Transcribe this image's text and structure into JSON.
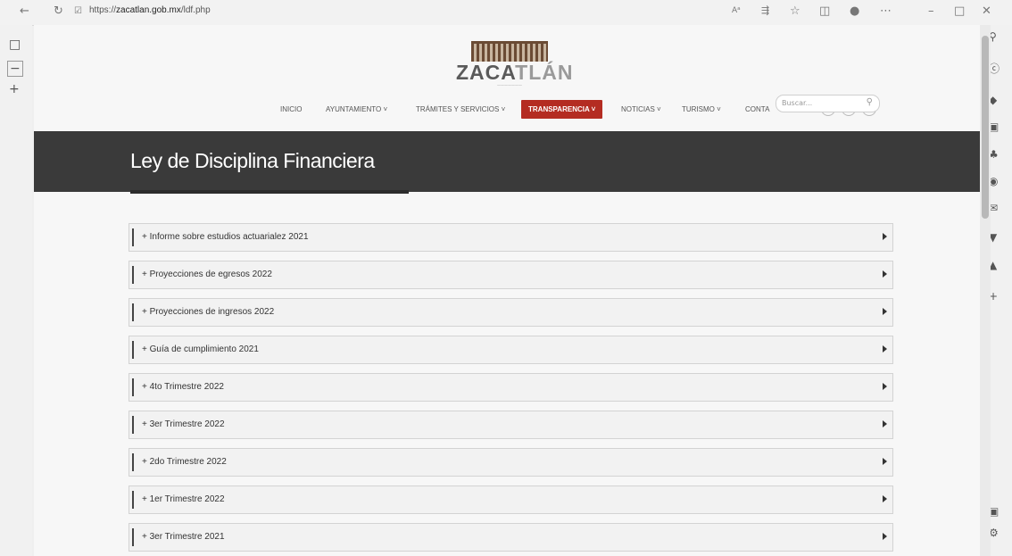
{
  "browser": {
    "url_prefix": "https://",
    "url_host": "zacatlan.gob.mx",
    "url_path": "/ldf.php",
    "read_aloud": "Aᵃ"
  },
  "site": {
    "logo_text_dark": "ZACA",
    "logo_text_light": "TLÁN",
    "nav": [
      "INICIO",
      "AYUNTAMIENTO ˅",
      "TRÁMITES Y SERVICIOS ˅",
      "TRANSPARENCIA ˅",
      "NOTICIAS ˅",
      "TURISMO ˅",
      "CONTA"
    ],
    "search_placeholder": "Buscar..."
  },
  "page": {
    "title": "Ley de Disciplina Financiera",
    "items": [
      {
        "label": "+ Informe sobre estudios actuarialez 2021"
      },
      {
        "label": "+ Proyecciones de egresos 2022"
      },
      {
        "label": "+ Proyecciones de ingresos 2022"
      },
      {
        "label": "+ Guía de cumplimiento 2021"
      },
      {
        "label": "+ 4to Trimestre 2022"
      },
      {
        "label": "+ 3er Trimestre 2022"
      },
      {
        "label": "+ 2do Trimestre 2022"
      },
      {
        "label": "+ 1er Trimestre 2022"
      },
      {
        "label": "+ 3er Trimestre 2021"
      }
    ]
  },
  "colors": {
    "active_nav": "#b42c22",
    "hero_bg": "#3a3a3a"
  }
}
